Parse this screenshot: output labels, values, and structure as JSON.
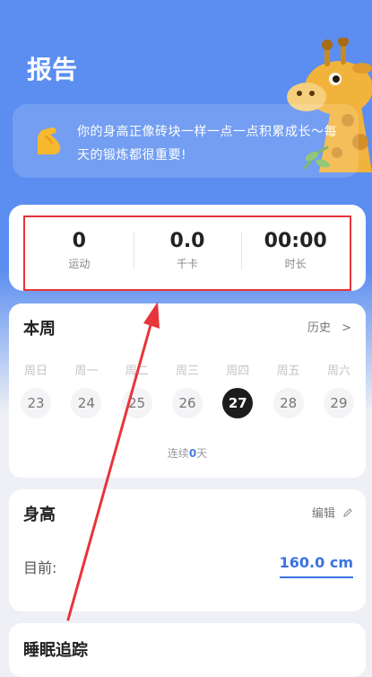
{
  "header": {
    "title": "报告"
  },
  "tip": {
    "text": "你的身高正像砖块一样一点一点积累成长～每天的锻炼都很重要!"
  },
  "stats": [
    {
      "value": "0",
      "label": "运动"
    },
    {
      "value": "0.0",
      "label": "千卡"
    },
    {
      "value": "00:00",
      "label": "时长"
    }
  ],
  "week": {
    "title": "本周",
    "history_label": "历史",
    "history_chevron": ">",
    "days": [
      {
        "name": "周日",
        "date": "23"
      },
      {
        "name": "周一",
        "date": "24"
      },
      {
        "name": "周二",
        "date": "25"
      },
      {
        "name": "周三",
        "date": "26"
      },
      {
        "name": "周四",
        "date": "27"
      },
      {
        "name": "周五",
        "date": "28"
      },
      {
        "name": "周六",
        "date": "29"
      }
    ],
    "active_index": 4,
    "streak_prefix": "连续",
    "streak_count": "0",
    "streak_suffix": "天"
  },
  "height": {
    "title": "身高",
    "edit_label": "编辑",
    "current_label": "目前:",
    "current_value": "160.0 cm"
  },
  "sleep": {
    "title": "睡眠追踪"
  },
  "colors": {
    "hero": "#5b8ef0",
    "accent": "#3a73e0",
    "annotation": "#e8343b"
  }
}
